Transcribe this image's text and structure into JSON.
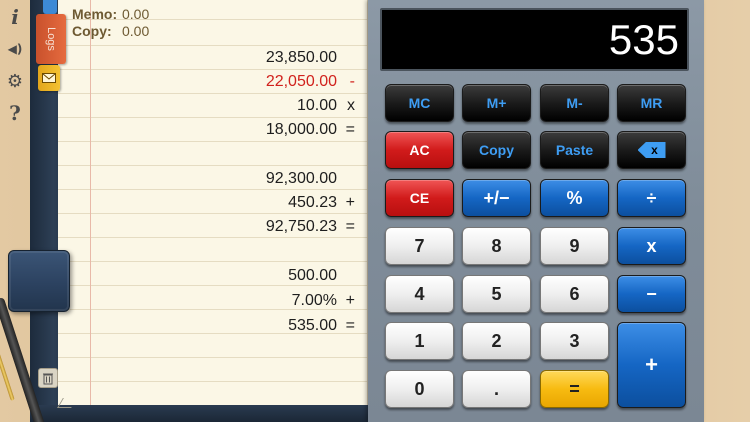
{
  "toolbar": {
    "info_glyph": "i",
    "sound_glyph": "◀)",
    "settings_glyph": "⚙",
    "help_glyph": "?"
  },
  "notebook": {
    "logs_tab_label": "Logs",
    "memo_label": "Memo:",
    "memo_value": "0.00",
    "copy_label": "Copy:",
    "copy_value": "0.00",
    "log_lines": [
      {
        "value": "23,850.00",
        "op": ""
      },
      {
        "value": "22,050.00",
        "op": "-",
        "color": "#d1221d"
      },
      {
        "value": "10.00",
        "op": "x"
      },
      {
        "value": "18,000.00",
        "op": "="
      },
      {
        "value": "",
        "op": ""
      },
      {
        "value": "92,300.00",
        "op": ""
      },
      {
        "value": "450.23",
        "op": "+"
      },
      {
        "value": "92,750.23",
        "op": "="
      },
      {
        "value": "",
        "op": ""
      },
      {
        "value": "500.00",
        "op": ""
      },
      {
        "value": "7.00%",
        "op": "+"
      },
      {
        "value": "535.00",
        "op": "="
      }
    ]
  },
  "calculator": {
    "display": "535",
    "keys": {
      "mc": "MC",
      "mplus": "M+",
      "mminus": "M-",
      "mr": "MR",
      "ac": "AC",
      "copy": "Copy",
      "paste": "Paste",
      "backspace": "x",
      "ce": "CE",
      "plusminus": "+/−",
      "percent": "%",
      "divide": "÷",
      "seven": "7",
      "eight": "8",
      "nine": "9",
      "multiply": "x",
      "four": "4",
      "five": "5",
      "six": "6",
      "minus": "−",
      "one": "1",
      "two": "2",
      "three": "3",
      "plus": "+",
      "zero": "0",
      "decimal": ".",
      "equals": "="
    },
    "colors": {
      "memory_text": "#3e9df3",
      "clear_red": "#d11b1b",
      "operator_blue": "#1566c4",
      "equals_yellow": "#f7bb11"
    }
  }
}
